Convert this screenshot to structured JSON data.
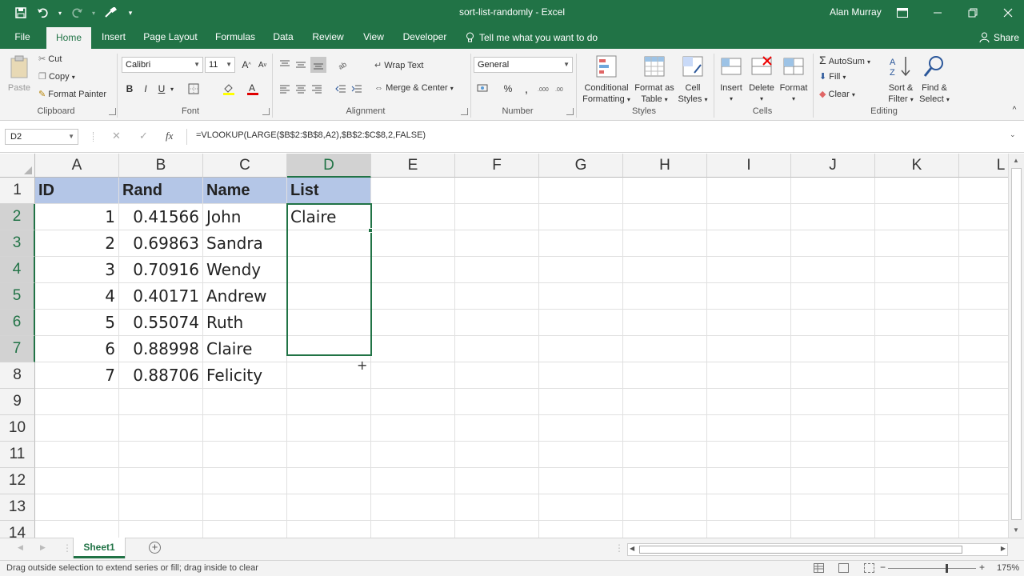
{
  "window": {
    "title": "sort-list-randomly - Excel",
    "user": "Alan Murray"
  },
  "tabs": [
    {
      "label": "File"
    },
    {
      "label": "Home"
    },
    {
      "label": "Insert"
    },
    {
      "label": "Page Layout"
    },
    {
      "label": "Formulas"
    },
    {
      "label": "Data"
    },
    {
      "label": "Review"
    },
    {
      "label": "View"
    },
    {
      "label": "Developer"
    }
  ],
  "tell_me": "Tell me what you want to do",
  "share": "Share",
  "ribbon": {
    "clipboard": {
      "label": "Clipboard",
      "paste": "Paste",
      "cut": "Cut",
      "copy": "Copy",
      "format_painter": "Format Painter"
    },
    "font": {
      "label": "Font",
      "name": "Calibri",
      "size": "11",
      "bold": "B",
      "italic": "I",
      "underline": "U"
    },
    "alignment": {
      "label": "Alignment",
      "wrap_text": "Wrap Text",
      "merge_center": "Merge & Center"
    },
    "number": {
      "label": "Number",
      "format": "General",
      "percent": "%"
    },
    "styles": {
      "label": "Styles",
      "conditional": "Conditional",
      "conditional2": "Formatting",
      "format_as": "Format as",
      "format_as2": "Table",
      "cell": "Cell",
      "cell2": "Styles"
    },
    "cells": {
      "label": "Cells",
      "insert": "Insert",
      "delete": "Delete",
      "format": "Format"
    },
    "editing": {
      "label": "Editing",
      "autosum": "AutoSum",
      "fill": "Fill",
      "clear": "Clear",
      "sort": "Sort &",
      "sort2": "Filter",
      "find": "Find &",
      "find2": "Select"
    }
  },
  "formula_bar": {
    "name_box": "D2",
    "fx": "fx",
    "formula": "=VLOOKUP(LARGE($B$2:$B$8,A2),$B$2:$C$8,2,FALSE)"
  },
  "columns": [
    "A",
    "B",
    "C",
    "D",
    "E",
    "F",
    "G",
    "H",
    "I",
    "J",
    "K",
    "L"
  ],
  "rows": [
    "1",
    "2",
    "3",
    "4",
    "5",
    "6",
    "7",
    "8",
    "9",
    "10",
    "11",
    "12",
    "13",
    "14"
  ],
  "cells": {
    "header": {
      "id": "ID",
      "rand": "Rand",
      "name": "Name",
      "list": "List"
    },
    "data": [
      {
        "id": "1",
        "rand": "0.41566",
        "name": "John",
        "list": "Claire"
      },
      {
        "id": "2",
        "rand": "0.69863",
        "name": "Sandra",
        "list": ""
      },
      {
        "id": "3",
        "rand": "0.70916",
        "name": "Wendy",
        "list": ""
      },
      {
        "id": "4",
        "rand": "0.40171",
        "name": "Andrew",
        "list": ""
      },
      {
        "id": "5",
        "rand": "0.55074",
        "name": "Ruth",
        "list": ""
      },
      {
        "id": "6",
        "rand": "0.88998",
        "name": "Claire",
        "list": ""
      },
      {
        "id": "7",
        "rand": "0.88706",
        "name": "Felicity",
        "list": ""
      }
    ]
  },
  "sheets": [
    {
      "label": "Sheet1"
    }
  ],
  "status": {
    "message": "Drag outside selection to extend series or fill; drag inside to clear",
    "zoom": "175%"
  },
  "colors": {
    "accent": "#217346",
    "header_fill": "#b4c6e7"
  }
}
